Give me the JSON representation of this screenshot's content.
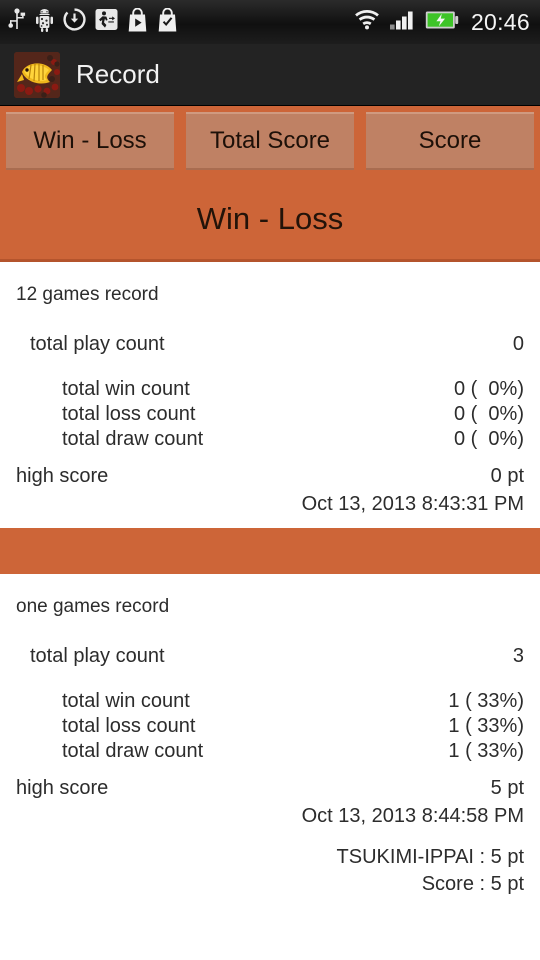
{
  "statusbar": {
    "time": "20:46",
    "left_icons": [
      {
        "name": "usb-icon"
      },
      {
        "name": "android-debug-icon"
      },
      {
        "name": "download-sync-icon"
      },
      {
        "name": "running-app-icon"
      },
      {
        "name": "play-store-icon"
      },
      {
        "name": "checkmark-bag-icon"
      }
    ],
    "right_icons": [
      {
        "name": "wifi-icon"
      },
      {
        "name": "signal-bars-icon"
      },
      {
        "name": "battery-charging-icon"
      }
    ]
  },
  "titlebar": {
    "app_name": "Record",
    "icon_name": "fish-app-icon"
  },
  "tabs": [
    {
      "label": "Win - Loss",
      "selected": true
    },
    {
      "label": "Total Score",
      "selected": false
    },
    {
      "label": "Score",
      "selected": false
    }
  ],
  "page_heading": "Win - Loss",
  "sections": [
    {
      "title": "12 games record",
      "play_count_label": "total play count",
      "play_count_value": "0",
      "win_label": "total win count",
      "win_value": "0 (  0%)",
      "loss_label": "total loss count",
      "loss_value": "0 (  0%)",
      "draw_label": "total draw count",
      "draw_value": "0 (  0%)",
      "high_score_label": "high score",
      "high_score_value": "0 pt",
      "high_score_date": "Oct 13, 2013 8:43:31 PM",
      "details": []
    },
    {
      "title": "one games record",
      "play_count_label": "total play count",
      "play_count_value": "3",
      "win_label": "total win count",
      "win_value": "1 ( 33%)",
      "loss_label": "total loss count",
      "loss_value": "1 ( 33%)",
      "draw_label": "total draw count",
      "draw_value": "1 ( 33%)",
      "high_score_label": "high score",
      "high_score_value": "5 pt",
      "high_score_date": "Oct 13, 2013 8:44:58 PM",
      "details": [
        "TSUKIMI-IPPAI : 5 pt",
        "Score : 5 pt"
      ]
    }
  ],
  "colors": {
    "accent_orange": "#cd6538",
    "tab_fill": "#bf8164",
    "titlebar_dark": "#232323",
    "text_dark": "#2c2c2c"
  }
}
